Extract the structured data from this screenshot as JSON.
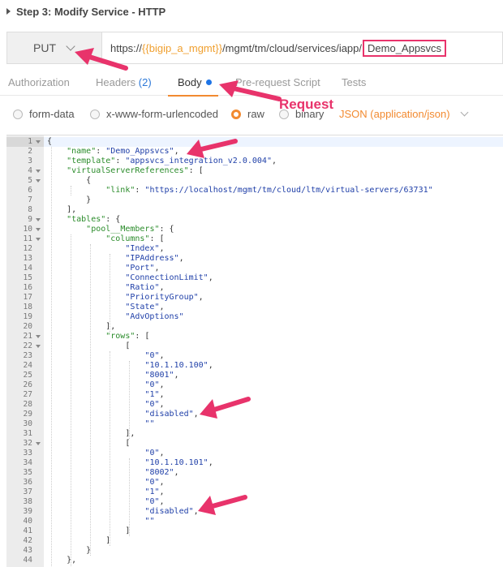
{
  "step_title": "Step 3: Modify Service - HTTP",
  "request": {
    "method": "PUT",
    "url_prefix": "https://",
    "url_var": "{{bigip_a_mgmt}}",
    "url_path": "/mgmt/tm/cloud/services/iapp/",
    "url_highlight": "Demo_Appsvcs"
  },
  "tabs": {
    "authorization": "Authorization",
    "headers": "Headers",
    "headers_count": "(2)",
    "body": "Body",
    "prerequest": "Pre-request Script",
    "tests": "Tests"
  },
  "body_options": {
    "form_data": "form-data",
    "urlencoded": "x-www-form-urlencoded",
    "raw": "raw",
    "binary": "binary",
    "content_type": "JSON (application/json)"
  },
  "annotation_label": "Request",
  "editor": {
    "lines": [
      {
        "n": "1",
        "fold": true,
        "t": [
          [
            "p",
            "{"
          ]
        ]
      },
      {
        "n": "2",
        "fold": false,
        "t": [
          [
            "p",
            "    "
          ],
          [
            "k",
            "\"name\""
          ],
          [
            "p",
            ": "
          ],
          [
            "s",
            "\"Demo_Appsvcs\""
          ],
          [
            "p",
            ","
          ]
        ]
      },
      {
        "n": "3",
        "fold": false,
        "t": [
          [
            "p",
            "    "
          ],
          [
            "k",
            "\"template\""
          ],
          [
            "p",
            ": "
          ],
          [
            "s",
            "\"appsvcs_integration_v2.0.004\""
          ],
          [
            "p",
            ","
          ]
        ]
      },
      {
        "n": "4",
        "fold": true,
        "t": [
          [
            "p",
            "    "
          ],
          [
            "k",
            "\"virtualServerReferences\""
          ],
          [
            "p",
            ": ["
          ]
        ]
      },
      {
        "n": "5",
        "fold": true,
        "t": [
          [
            "p",
            "        {"
          ]
        ]
      },
      {
        "n": "6",
        "fold": false,
        "t": [
          [
            "p",
            "            "
          ],
          [
            "k",
            "\"link\""
          ],
          [
            "p",
            ": "
          ],
          [
            "s",
            "\"https://localhost/mgmt/tm/cloud/ltm/virtual-servers/63731\""
          ]
        ]
      },
      {
        "n": "7",
        "fold": false,
        "t": [
          [
            "p",
            "        }"
          ]
        ]
      },
      {
        "n": "8",
        "fold": false,
        "t": [
          [
            "p",
            "    ],"
          ]
        ]
      },
      {
        "n": "9",
        "fold": true,
        "t": [
          [
            "p",
            "    "
          ],
          [
            "k",
            "\"tables\""
          ],
          [
            "p",
            ": {"
          ]
        ]
      },
      {
        "n": "10",
        "fold": true,
        "t": [
          [
            "p",
            "        "
          ],
          [
            "k",
            "\"pool__Members\""
          ],
          [
            "p",
            ": {"
          ]
        ]
      },
      {
        "n": "11",
        "fold": true,
        "t": [
          [
            "p",
            "            "
          ],
          [
            "k",
            "\"columns\""
          ],
          [
            "p",
            ": ["
          ]
        ]
      },
      {
        "n": "12",
        "fold": false,
        "t": [
          [
            "p",
            "                "
          ],
          [
            "s",
            "\"Index\""
          ],
          [
            "p",
            ","
          ]
        ]
      },
      {
        "n": "13",
        "fold": false,
        "t": [
          [
            "p",
            "                "
          ],
          [
            "s",
            "\"IPAddress\""
          ],
          [
            "p",
            ","
          ]
        ]
      },
      {
        "n": "14",
        "fold": false,
        "t": [
          [
            "p",
            "                "
          ],
          [
            "s",
            "\"Port\""
          ],
          [
            "p",
            ","
          ]
        ]
      },
      {
        "n": "15",
        "fold": false,
        "t": [
          [
            "p",
            "                "
          ],
          [
            "s",
            "\"ConnectionLimit\""
          ],
          [
            "p",
            ","
          ]
        ]
      },
      {
        "n": "16",
        "fold": false,
        "t": [
          [
            "p",
            "                "
          ],
          [
            "s",
            "\"Ratio\""
          ],
          [
            "p",
            ","
          ]
        ]
      },
      {
        "n": "17",
        "fold": false,
        "t": [
          [
            "p",
            "                "
          ],
          [
            "s",
            "\"PriorityGroup\""
          ],
          [
            "p",
            ","
          ]
        ]
      },
      {
        "n": "18",
        "fold": false,
        "t": [
          [
            "p",
            "                "
          ],
          [
            "s",
            "\"State\""
          ],
          [
            "p",
            ","
          ]
        ]
      },
      {
        "n": "19",
        "fold": false,
        "t": [
          [
            "p",
            "                "
          ],
          [
            "s",
            "\"AdvOptions\""
          ]
        ]
      },
      {
        "n": "20",
        "fold": false,
        "t": [
          [
            "p",
            "            ],"
          ]
        ]
      },
      {
        "n": "21",
        "fold": true,
        "t": [
          [
            "p",
            "            "
          ],
          [
            "k",
            "\"rows\""
          ],
          [
            "p",
            ": ["
          ]
        ]
      },
      {
        "n": "22",
        "fold": true,
        "t": [
          [
            "p",
            "                ["
          ]
        ]
      },
      {
        "n": "23",
        "fold": false,
        "t": [
          [
            "p",
            "                    "
          ],
          [
            "s",
            "\"0\""
          ],
          [
            "p",
            ","
          ]
        ]
      },
      {
        "n": "24",
        "fold": false,
        "t": [
          [
            "p",
            "                    "
          ],
          [
            "s",
            "\"10.1.10.100\""
          ],
          [
            "p",
            ","
          ]
        ]
      },
      {
        "n": "25",
        "fold": false,
        "t": [
          [
            "p",
            "                    "
          ],
          [
            "s",
            "\"8001\""
          ],
          [
            "p",
            ","
          ]
        ]
      },
      {
        "n": "26",
        "fold": false,
        "t": [
          [
            "p",
            "                    "
          ],
          [
            "s",
            "\"0\""
          ],
          [
            "p",
            ","
          ]
        ]
      },
      {
        "n": "27",
        "fold": false,
        "t": [
          [
            "p",
            "                    "
          ],
          [
            "s",
            "\"1\""
          ],
          [
            "p",
            ","
          ]
        ]
      },
      {
        "n": "28",
        "fold": false,
        "t": [
          [
            "p",
            "                    "
          ],
          [
            "s",
            "\"0\""
          ],
          [
            "p",
            ","
          ]
        ]
      },
      {
        "n": "29",
        "fold": false,
        "t": [
          [
            "p",
            "                    "
          ],
          [
            "s",
            "\"disabled\""
          ],
          [
            "p",
            ","
          ]
        ]
      },
      {
        "n": "30",
        "fold": false,
        "t": [
          [
            "p",
            "                    "
          ],
          [
            "s",
            "\"\""
          ]
        ]
      },
      {
        "n": "31",
        "fold": false,
        "t": [
          [
            "p",
            "                ],"
          ]
        ]
      },
      {
        "n": "32",
        "fold": true,
        "t": [
          [
            "p",
            "                ["
          ]
        ]
      },
      {
        "n": "33",
        "fold": false,
        "t": [
          [
            "p",
            "                    "
          ],
          [
            "s",
            "\"0\""
          ],
          [
            "p",
            ","
          ]
        ]
      },
      {
        "n": "34",
        "fold": false,
        "t": [
          [
            "p",
            "                    "
          ],
          [
            "s",
            "\"10.1.10.101\""
          ],
          [
            "p",
            ","
          ]
        ]
      },
      {
        "n": "35",
        "fold": false,
        "t": [
          [
            "p",
            "                    "
          ],
          [
            "s",
            "\"8002\""
          ],
          [
            "p",
            ","
          ]
        ]
      },
      {
        "n": "36",
        "fold": false,
        "t": [
          [
            "p",
            "                    "
          ],
          [
            "s",
            "\"0\""
          ],
          [
            "p",
            ","
          ]
        ]
      },
      {
        "n": "37",
        "fold": false,
        "t": [
          [
            "p",
            "                    "
          ],
          [
            "s",
            "\"1\""
          ],
          [
            "p",
            ","
          ]
        ]
      },
      {
        "n": "38",
        "fold": false,
        "t": [
          [
            "p",
            "                    "
          ],
          [
            "s",
            "\"0\""
          ],
          [
            "p",
            ","
          ]
        ]
      },
      {
        "n": "39",
        "fold": false,
        "t": [
          [
            "p",
            "                    "
          ],
          [
            "s",
            "\"disabled\""
          ],
          [
            "p",
            ","
          ]
        ]
      },
      {
        "n": "40",
        "fold": false,
        "t": [
          [
            "p",
            "                    "
          ],
          [
            "s",
            "\"\""
          ]
        ]
      },
      {
        "n": "41",
        "fold": false,
        "t": [
          [
            "p",
            "                ]"
          ]
        ]
      },
      {
        "n": "42",
        "fold": false,
        "t": [
          [
            "p",
            "            ]"
          ]
        ]
      },
      {
        "n": "43",
        "fold": false,
        "t": [
          [
            "p",
            "        }"
          ]
        ]
      },
      {
        "n": "44",
        "fold": false,
        "t": [
          [
            "p",
            "    },"
          ]
        ]
      }
    ]
  },
  "colors": {
    "accent": "#f28a30",
    "annotation": "#e8336b",
    "json_key": "#2b8c2b",
    "json_string": "#1f3fa8",
    "tab_count": "#2c78d8"
  }
}
